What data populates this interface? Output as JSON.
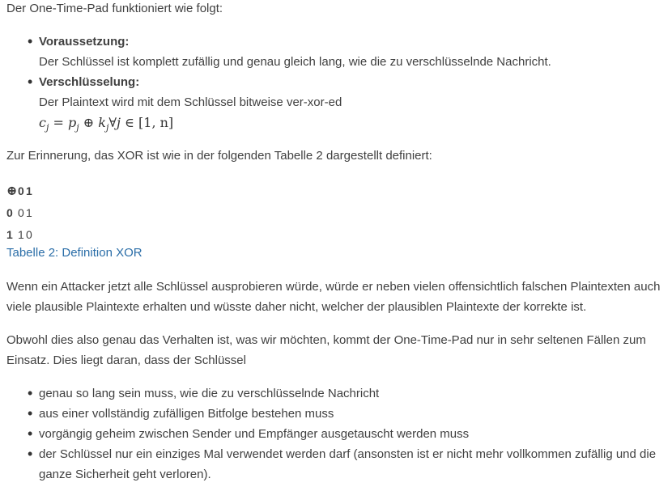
{
  "intro": "Der One-Time-Pad funktioniert wie folgt:",
  "requirements": [
    {
      "term": "Voraussetzung:",
      "desc": "Der Schlüssel ist komplett zufällig und genau gleich lang, wie die zu verschlüsselnde Nachricht."
    },
    {
      "term": "Verschlüsselung:",
      "desc": "Der Plaintext wird mit dem Schlüssel bitweise ver-xor-ed",
      "formula": {
        "c": "c",
        "c_sub": "j",
        "eq": "=",
        "p": "p",
        "p_sub": "j",
        "op": "⊕",
        "k": "k",
        "k_sub": "j",
        "forall": "∀",
        "j": "j",
        "in": "∈",
        "interval": "[1, n]"
      }
    }
  ],
  "reminder": "Zur Erinnerung, das XOR ist wie in der folgenden Tabelle 2 dargestellt definiert:",
  "xor_table": {
    "op": "⊕",
    "header": [
      "0",
      "1"
    ],
    "rows": [
      {
        "label": "0",
        "values": [
          "0",
          "1"
        ]
      },
      {
        "label": "1",
        "values": [
          "1",
          "0"
        ]
      }
    ]
  },
  "caption": "Tabelle 2: Definition XOR",
  "attack_paragraph": "Wenn ein Attacker jetzt alle Schlüssel ausprobieren würde, würde er neben vielen offensichtlich falschen Plaintexten auch viele plausible Plaintexte erhalten und wüsste daher nicht, welcher der plausiblen Plaintexte der korrekte ist.",
  "usage_paragraph": "Obwohl dies also genau das Verhalten ist, was wir möchten, kommt der One-Time-Pad nur in sehr seltenen Fällen zum Einsatz. Dies liegt daran, dass der Schlüssel",
  "key_conditions": [
    "genau so lang sein muss, wie die zu verschlüsselnde Nachricht",
    "aus einer vollständig zufälligen Bitfolge bestehen muss",
    "vorgängig geheim zwischen Sender und Empfänger ausgetauscht werden muss",
    "der Schlüssel nur ein einziges Mal verwendet werden darf (ansonsten ist er nicht mehr vollkommen zufällig und die ganze Sicherheit geht verloren)."
  ]
}
